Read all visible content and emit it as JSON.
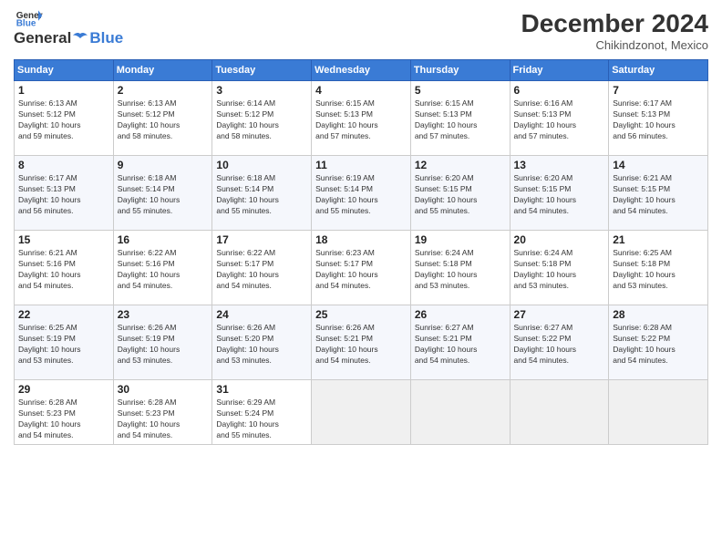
{
  "header": {
    "logo_general": "General",
    "logo_blue": "Blue",
    "month_title": "December 2024",
    "location": "Chikindzonot, Mexico"
  },
  "days_of_week": [
    "Sunday",
    "Monday",
    "Tuesday",
    "Wednesday",
    "Thursday",
    "Friday",
    "Saturday"
  ],
  "weeks": [
    [
      {
        "day": "1",
        "sunrise": "6:13 AM",
        "sunset": "5:12 PM",
        "daylight": "10 hours and 59 minutes."
      },
      {
        "day": "2",
        "sunrise": "6:13 AM",
        "sunset": "5:12 PM",
        "daylight": "10 hours and 58 minutes."
      },
      {
        "day": "3",
        "sunrise": "6:14 AM",
        "sunset": "5:12 PM",
        "daylight": "10 hours and 58 minutes."
      },
      {
        "day": "4",
        "sunrise": "6:15 AM",
        "sunset": "5:13 PM",
        "daylight": "10 hours and 57 minutes."
      },
      {
        "day": "5",
        "sunrise": "6:15 AM",
        "sunset": "5:13 PM",
        "daylight": "10 hours and 57 minutes."
      },
      {
        "day": "6",
        "sunrise": "6:16 AM",
        "sunset": "5:13 PM",
        "daylight": "10 hours and 57 minutes."
      },
      {
        "day": "7",
        "sunrise": "6:17 AM",
        "sunset": "5:13 PM",
        "daylight": "10 hours and 56 minutes."
      }
    ],
    [
      {
        "day": "8",
        "sunrise": "6:17 AM",
        "sunset": "5:13 PM",
        "daylight": "10 hours and 56 minutes."
      },
      {
        "day": "9",
        "sunrise": "6:18 AM",
        "sunset": "5:14 PM",
        "daylight": "10 hours and 55 minutes."
      },
      {
        "day": "10",
        "sunrise": "6:18 AM",
        "sunset": "5:14 PM",
        "daylight": "10 hours and 55 minutes."
      },
      {
        "day": "11",
        "sunrise": "6:19 AM",
        "sunset": "5:14 PM",
        "daylight": "10 hours and 55 minutes."
      },
      {
        "day": "12",
        "sunrise": "6:20 AM",
        "sunset": "5:15 PM",
        "daylight": "10 hours and 55 minutes."
      },
      {
        "day": "13",
        "sunrise": "6:20 AM",
        "sunset": "5:15 PM",
        "daylight": "10 hours and 54 minutes."
      },
      {
        "day": "14",
        "sunrise": "6:21 AM",
        "sunset": "5:15 PM",
        "daylight": "10 hours and 54 minutes."
      }
    ],
    [
      {
        "day": "15",
        "sunrise": "6:21 AM",
        "sunset": "5:16 PM",
        "daylight": "10 hours and 54 minutes."
      },
      {
        "day": "16",
        "sunrise": "6:22 AM",
        "sunset": "5:16 PM",
        "daylight": "10 hours and 54 minutes."
      },
      {
        "day": "17",
        "sunrise": "6:22 AM",
        "sunset": "5:17 PM",
        "daylight": "10 hours and 54 minutes."
      },
      {
        "day": "18",
        "sunrise": "6:23 AM",
        "sunset": "5:17 PM",
        "daylight": "10 hours and 54 minutes."
      },
      {
        "day": "19",
        "sunrise": "6:24 AM",
        "sunset": "5:18 PM",
        "daylight": "10 hours and 53 minutes."
      },
      {
        "day": "20",
        "sunrise": "6:24 AM",
        "sunset": "5:18 PM",
        "daylight": "10 hours and 53 minutes."
      },
      {
        "day": "21",
        "sunrise": "6:25 AM",
        "sunset": "5:18 PM",
        "daylight": "10 hours and 53 minutes."
      }
    ],
    [
      {
        "day": "22",
        "sunrise": "6:25 AM",
        "sunset": "5:19 PM",
        "daylight": "10 hours and 53 minutes."
      },
      {
        "day": "23",
        "sunrise": "6:26 AM",
        "sunset": "5:19 PM",
        "daylight": "10 hours and 53 minutes."
      },
      {
        "day": "24",
        "sunrise": "6:26 AM",
        "sunset": "5:20 PM",
        "daylight": "10 hours and 53 minutes."
      },
      {
        "day": "25",
        "sunrise": "6:26 AM",
        "sunset": "5:21 PM",
        "daylight": "10 hours and 54 minutes."
      },
      {
        "day": "26",
        "sunrise": "6:27 AM",
        "sunset": "5:21 PM",
        "daylight": "10 hours and 54 minutes."
      },
      {
        "day": "27",
        "sunrise": "6:27 AM",
        "sunset": "5:22 PM",
        "daylight": "10 hours and 54 minutes."
      },
      {
        "day": "28",
        "sunrise": "6:28 AM",
        "sunset": "5:22 PM",
        "daylight": "10 hours and 54 minutes."
      }
    ],
    [
      {
        "day": "29",
        "sunrise": "6:28 AM",
        "sunset": "5:23 PM",
        "daylight": "10 hours and 54 minutes."
      },
      {
        "day": "30",
        "sunrise": "6:28 AM",
        "sunset": "5:23 PM",
        "daylight": "10 hours and 54 minutes."
      },
      {
        "day": "31",
        "sunrise": "6:29 AM",
        "sunset": "5:24 PM",
        "daylight": "10 hours and 55 minutes."
      },
      null,
      null,
      null,
      null
    ]
  ]
}
